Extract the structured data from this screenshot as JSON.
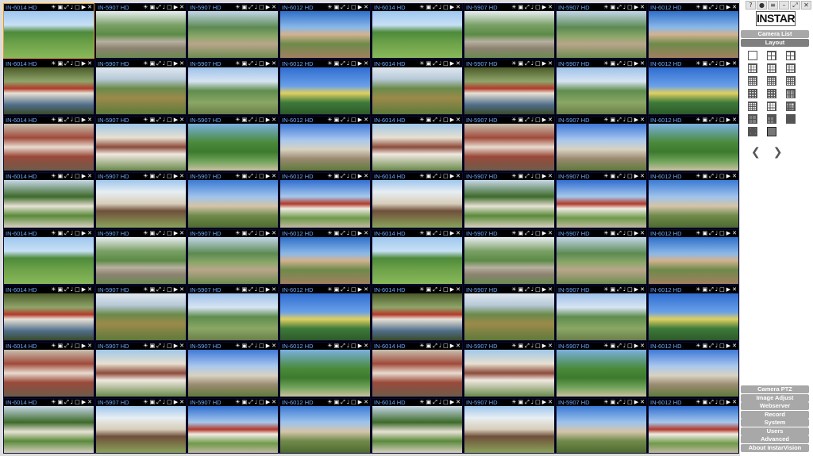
{
  "grid": {
    "cells": [
      {
        "name": "IN-6014 HD",
        "scene": 0
      },
      {
        "name": "IN-5907 HD",
        "scene": 1
      },
      {
        "name": "IN-5907 HD",
        "scene": 2
      },
      {
        "name": "IN-6012 HD",
        "scene": 3
      },
      {
        "name": "IN-6014 HD",
        "scene": 0
      },
      {
        "name": "IN-5907 HD",
        "scene": 1
      },
      {
        "name": "IN-5907 HD",
        "scene": 2
      },
      {
        "name": "IN-6012 HD",
        "scene": 3
      },
      {
        "name": "IN-6014 HD",
        "scene": 4
      },
      {
        "name": "IN-5907 HD",
        "scene": 5
      },
      {
        "name": "IN-5907 HD",
        "scene": 6
      },
      {
        "name": "IN-6012 HD",
        "scene": 7
      },
      {
        "name": "IN-6014 HD",
        "scene": 5
      },
      {
        "name": "IN-5907 HD",
        "scene": 4
      },
      {
        "name": "IN-5907 HD",
        "scene": 6
      },
      {
        "name": "IN-6012 HD",
        "scene": 7
      },
      {
        "name": "IN-6014 HD",
        "scene": 8
      },
      {
        "name": "IN-5907 HD",
        "scene": 9
      },
      {
        "name": "IN-5907 HD",
        "scene": 10
      },
      {
        "name": "IN-6012 HD",
        "scene": 11
      },
      {
        "name": "IN-6014 HD",
        "scene": 9
      },
      {
        "name": "IN-5907 HD",
        "scene": 8
      },
      {
        "name": "IN-5907 HD",
        "scene": 11
      },
      {
        "name": "IN-6012 HD",
        "scene": 10
      },
      {
        "name": "IN-6014 HD",
        "scene": 12
      },
      {
        "name": "IN-5907 HD",
        "scene": 13
      },
      {
        "name": "IN-5907 HD",
        "scene": 14
      },
      {
        "name": "IN-6012 HD",
        "scene": 15
      },
      {
        "name": "IN-6014 HD",
        "scene": 13
      },
      {
        "name": "IN-5907 HD",
        "scene": 12
      },
      {
        "name": "IN-5907 HD",
        "scene": 15
      },
      {
        "name": "IN-6012 HD",
        "scene": 14
      },
      {
        "name": "IN-6014 HD",
        "scene": 0
      },
      {
        "name": "IN-5907 HD",
        "scene": 1
      },
      {
        "name": "IN-5907 HD",
        "scene": 2
      },
      {
        "name": "IN-6012 HD",
        "scene": 3
      },
      {
        "name": "IN-6014 HD",
        "scene": 0
      },
      {
        "name": "IN-5907 HD",
        "scene": 1
      },
      {
        "name": "IN-5907 HD",
        "scene": 2
      },
      {
        "name": "IN-6012 HD",
        "scene": 3
      },
      {
        "name": "IN-6014 HD",
        "scene": 4
      },
      {
        "name": "IN-5907 HD",
        "scene": 5
      },
      {
        "name": "IN-5907 HD",
        "scene": 6
      },
      {
        "name": "IN-6012 HD",
        "scene": 7
      },
      {
        "name": "IN-6014 HD",
        "scene": 4
      },
      {
        "name": "IN-5907 HD",
        "scene": 5
      },
      {
        "name": "IN-5907 HD",
        "scene": 6
      },
      {
        "name": "IN-6012 HD",
        "scene": 7
      },
      {
        "name": "IN-6014 HD",
        "scene": 8
      },
      {
        "name": "IN-5907 HD",
        "scene": 9
      },
      {
        "name": "IN-5907 HD",
        "scene": 11
      },
      {
        "name": "IN-6012 HD",
        "scene": 10
      },
      {
        "name": "IN-6014 HD",
        "scene": 8
      },
      {
        "name": "IN-5907 HD",
        "scene": 9
      },
      {
        "name": "IN-5907 HD",
        "scene": 10
      },
      {
        "name": "IN-6012 HD",
        "scene": 11
      },
      {
        "name": "IN-6014 HD",
        "scene": 12
      },
      {
        "name": "IN-5907 HD",
        "scene": 13
      },
      {
        "name": "IN-5907 HD",
        "scene": 15
      },
      {
        "name": "IN-6012 HD",
        "scene": 14
      },
      {
        "name": "IN-6014 HD",
        "scene": 12
      },
      {
        "name": "IN-5907 HD",
        "scene": 13
      },
      {
        "name": "IN-5907 HD",
        "scene": 14
      },
      {
        "name": "IN-6012 HD",
        "scene": 15
      }
    ],
    "selected_index": 0,
    "title_color": "#6fa8ff",
    "highlight_color": "#e09a20"
  },
  "side": {
    "window_buttons": [
      "?",
      "●",
      "≡",
      "–",
      "⤢",
      "✕"
    ],
    "logo": "INSTAR",
    "top_buttons": [
      {
        "label": "Camera List",
        "active": false
      },
      {
        "label": "Layout",
        "active": true
      }
    ],
    "layout_icons": [
      "layout-1x1-icon",
      "layout-1plus1-icon",
      "layout-2x2-icon",
      "layout-1plus3-icon",
      "layout-3x3-icon",
      "layout-1plus5-icon",
      "layout-4x4-icon",
      "layout-1plus7-icon",
      "layout-4x4-alt-icon",
      "layout-8x8-icon",
      "layout-5x5-icon",
      "layout-6x6-icon",
      "layout-1plus12-icon",
      "layout-2plus8-icon",
      "layout-7x7-icon",
      "layout-8x8-grid-icon",
      "layout-9x9-icon",
      "layout-10x10-icon",
      "layout-11x11-icon",
      "layout-12x12-icon"
    ],
    "active_layout_index": 19,
    "bottom_buttons": [
      "Camera PTZ",
      "Image Adjust",
      "Webserver",
      "Record",
      "System",
      "Users",
      "Advanced",
      "About InstarVision"
    ]
  }
}
